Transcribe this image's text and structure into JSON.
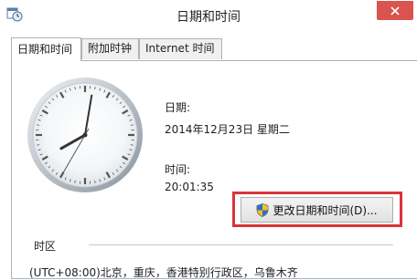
{
  "window": {
    "title": "日期和时间",
    "close_icon": "close-icon",
    "close_color": "#d9534f"
  },
  "tabs": [
    {
      "label": "日期和时间",
      "active": true
    },
    {
      "label": "附加时钟",
      "active": false
    },
    {
      "label": "Internet 时间",
      "active": false
    }
  ],
  "date_section": {
    "label": "日期:",
    "value": "2014年12月23日 星期二"
  },
  "time_section": {
    "label": "时间:",
    "value": "20:01:35"
  },
  "clock": {
    "hour": 20,
    "minute": 1,
    "second": 35
  },
  "change_button": {
    "label": "更改日期和时间(D)...",
    "icon": "shield-icon"
  },
  "highlight_color": "#d9343a",
  "timezone": {
    "section_label": "时区",
    "value": "(UTC+08:00)北京，重庆，香港特别行政区，乌鲁木齐"
  }
}
